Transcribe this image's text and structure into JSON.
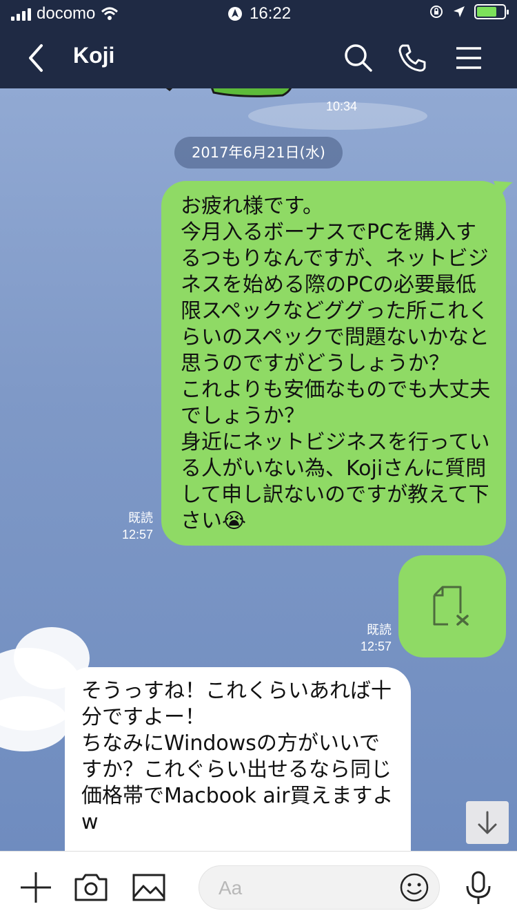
{
  "status_bar": {
    "carrier": "docomo",
    "time": "16:22"
  },
  "header": {
    "title": "Koji"
  },
  "chat": {
    "sticker_time": "10:34",
    "date": "2017年6月21日(水)",
    "messages": [
      {
        "direction": "out",
        "read_label": "既読",
        "time": "12:57",
        "text": "お疲れ様です。\n今月入るボーナスでPCを購入するつもりなんですが、ネットビジネスを始める際のPCの必要最低限スペックなどググった所これくらいのスペックで問題ないかなと思うのですがどうしょうか？\nこれよりも安価なものでも大丈夫でしょうか？\n身近にネットビジネスを行っている人がいない為、Kojiさんに質問して申し訳ないのですが教えて下さい",
        "emoji": "😭"
      },
      {
        "direction": "out",
        "read_label": "既読",
        "time": "12:57",
        "attachment": "file-missing-icon"
      },
      {
        "direction": "in",
        "text": "そうっすね！これくらいあれば十分ですよー！\nちなみにWindowsの方がいいですか？これぐらい出せるなら同じ価格帯でMacbook air買えますよw"
      }
    ]
  },
  "input": {
    "placeholder": "Aa"
  },
  "colors": {
    "header": "#1f2a44",
    "bubble_out": "#8fda65",
    "bubble_in": "#ffffff",
    "chat_bg": "#8aa3cf"
  }
}
